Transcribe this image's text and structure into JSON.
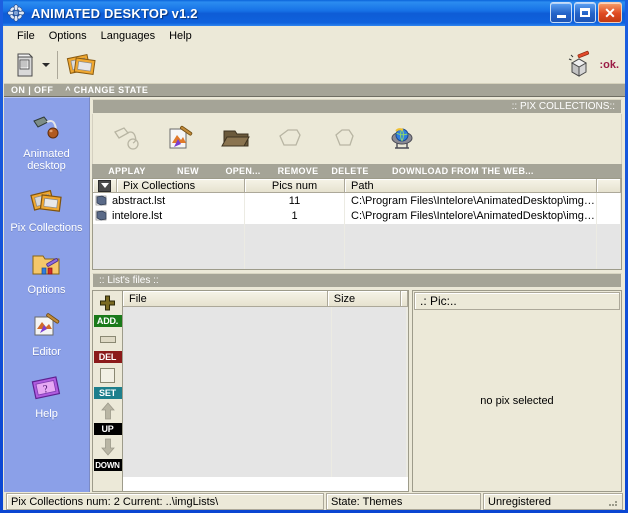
{
  "window": {
    "title": "ANIMATED DESKTOP v1.2",
    "app_icon": "flower-icon",
    "minimize": "_",
    "maximize": "□",
    "close": "✕"
  },
  "menu": {
    "items": [
      {
        "label": "File"
      },
      {
        "label": "Options"
      },
      {
        "label": "Languages"
      },
      {
        "label": "Help"
      }
    ]
  },
  "toolbar": {
    "state_button": "monitor-icon",
    "dropdown": "chevron-down-icon",
    "collections_button": "pix-collections-icon",
    "ok_icon": "cube-icon",
    "ok_text": ":ok."
  },
  "onoff_bar": {
    "state": "ON | OFF",
    "change": "^ CHANGE STATE"
  },
  "sidebar": {
    "items": [
      {
        "label": "Animated desktop",
        "line1": "Animated",
        "line2": "desktop",
        "icon": "paint-desktop-icon"
      },
      {
        "label": "Pix Collections",
        "line1": "Pix Collections",
        "line2": "",
        "icon": "collections-icon"
      },
      {
        "label": "Options",
        "line1": "Options",
        "line2": "",
        "icon": "options-folder-icon"
      },
      {
        "label": "Editor",
        "line1": "Editor",
        "line2": "",
        "icon": "editor-brush-icon"
      },
      {
        "label": "Help",
        "line1": "Help",
        "line2": "",
        "icon": "help-book-icon"
      }
    ]
  },
  "collections": {
    "header": ":: PIX COLLECTIONS::",
    "tools": [
      {
        "label": "APPLAY",
        "icon": "applay-icon",
        "enabled": false
      },
      {
        "label": "NEW",
        "icon": "new-icon",
        "enabled": true
      },
      {
        "label": "OPEN...",
        "icon": "open-folder-icon",
        "enabled": true
      },
      {
        "label": "REMOVE",
        "icon": "remove-icon",
        "enabled": false
      },
      {
        "label": "DELETE",
        "icon": "delete-icon",
        "enabled": false
      },
      {
        "label": "DOWNLOAD FROM THE WEB...",
        "icon": "globe-download-icon",
        "enabled": true
      }
    ],
    "columns": [
      "",
      "Pix Collections",
      "Pics num",
      "Path",
      ""
    ],
    "rows": [
      {
        "icon": "lst-file-icon",
        "name": "abstract.lst",
        "pics_num": "11",
        "path": "C:\\Program Files\\Intelore\\AnimatedDesktop\\img…"
      },
      {
        "icon": "lst-file-icon",
        "name": "intelore.lst",
        "pics_num": "1",
        "path": "C:\\Program Files\\Intelore\\AnimatedDesktop\\img…"
      }
    ]
  },
  "lists_files": {
    "header": ":: List's files ::",
    "buttons": [
      {
        "label": "ADD.",
        "icon": "plus-icon",
        "color": "#1a7a1a"
      },
      {
        "label": "DEL",
        "icon": "minus-icon",
        "color": "#8b1a1a"
      },
      {
        "label": "SET",
        "icon": "square-icon",
        "color": "#1d7f8c"
      },
      {
        "label": "UP",
        "icon": "arrow-up-icon",
        "color": "#000000"
      },
      {
        "label": "DOWN",
        "icon": "arrow-down-icon",
        "color": "#000000"
      }
    ],
    "columns": [
      "File",
      "Size",
      ""
    ],
    "rows": []
  },
  "pic_panel": {
    "header": ".: Pic:..",
    "empty_text": "no pix selected"
  },
  "statusbar": {
    "collections": "Pix Collections num: 2   Current: ..\\imgLists\\",
    "state": "State: Themes",
    "registration": "Unregistered"
  },
  "colors": {
    "title_blue": "#0a46d2",
    "sidebar_blue": "#8ba0e8",
    "panel_cream": "#ece9d8",
    "header_gray": "#a5a497",
    "accent_red": "#9b1b45",
    "add_green": "#1a7a1a",
    "del_red": "#8b1a1a",
    "set_teal": "#1d7f8c"
  }
}
